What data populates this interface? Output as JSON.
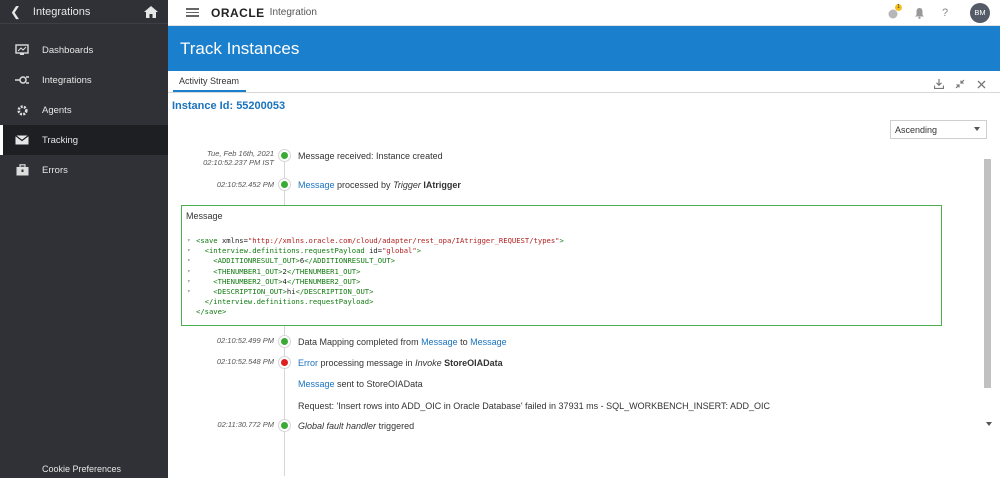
{
  "sidebar": {
    "header_title": "Integrations",
    "items": [
      {
        "label": "Dashboards",
        "icon": "monitor-icon"
      },
      {
        "label": "Integrations",
        "icon": "integration-plug-icon"
      },
      {
        "label": "Agents",
        "icon": "gear-icon"
      },
      {
        "label": "Tracking",
        "icon": "envelope-icon"
      },
      {
        "label": "Errors",
        "icon": "briefcase-icon"
      }
    ],
    "active_item": "Tracking",
    "footer_link": "Cookie Preferences"
  },
  "topbar": {
    "brand": "ORACLE",
    "product": "Integration",
    "notification_badge": "1",
    "help": "?",
    "avatar_initials": "BM"
  },
  "page": {
    "title": "Track Instances",
    "tab": "Activity Stream",
    "instance_label": "Instance Id:",
    "instance_id": "55200053",
    "sort_order": "Ascending"
  },
  "timeline": {
    "e1": {
      "date": "Tue, Feb 16th, 2021",
      "time": "02:10:52.237 PM IST",
      "text": "Message received: Instance created"
    },
    "e2": {
      "time": "02:10:52.452 PM",
      "link": "Message",
      "mid": " processed by ",
      "kind": "Trigger",
      "name": "IAtrigger"
    },
    "e3": {
      "time": "02:10:52.499 PM",
      "pre": "Data Mapping completed from ",
      "link1": "Message",
      "mid": " to ",
      "link2": "Message"
    },
    "e4": {
      "time": "02:10:52.548 PM",
      "link": "Error",
      "mid": " processing message in ",
      "kind": "Invoke",
      "name": "StoreOIAData"
    },
    "e4b": {
      "link": "Message",
      "text": " sent to StoreOIAData"
    },
    "e4c": {
      "text": "Request: 'Insert rows into ADD_OIC in Oracle Database' failed in 37931 ms - SQL_WORKBENCH_INSERT: ADD_OIC"
    },
    "e5": {
      "time": "02:11:30.772 PM",
      "italic": "Global fault handler",
      "text": " triggered"
    }
  },
  "message_box": {
    "title": "Message",
    "lines": {
      "l1a": "<save ",
      "l1b": "xmlns=",
      "l1c": "\"http://xmlns.oracle.com/cloud/adapter/rest_opa/IAtrigger_REQUEST/types\"",
      "l1d": ">",
      "l2a": "  <interview.definitions.requestPayload ",
      "l2b": "id=",
      "l2c": "\"global\"",
      "l2d": ">",
      "l3a": "    <ADDITIONRESULT_OUT>",
      "l3b": "6",
      "l3c": "</ADDITIONRESULT_OUT>",
      "l4a": "    <THENUMBER1_OUT>",
      "l4b": "2",
      "l4c": "</THENUMBER1_OUT>",
      "l5a": "    <THENUMBER2_OUT>",
      "l5b": "4",
      "l5c": "</THENUMBER2_OUT>",
      "l6a": "    <DESCRIPTION_OUT>",
      "l6b": "hi",
      "l6c": "</DESCRIPTION_OUT>",
      "l7": "  </interview.definitions.requestPayload>",
      "l8": "</save>"
    }
  },
  "colors": {
    "sidebar_bg": "#2f3136",
    "banner_blue": "#1a7fcc",
    "link_blue": "#1a73bf",
    "success_green": "#3aaa35",
    "error_red": "#e02020"
  }
}
